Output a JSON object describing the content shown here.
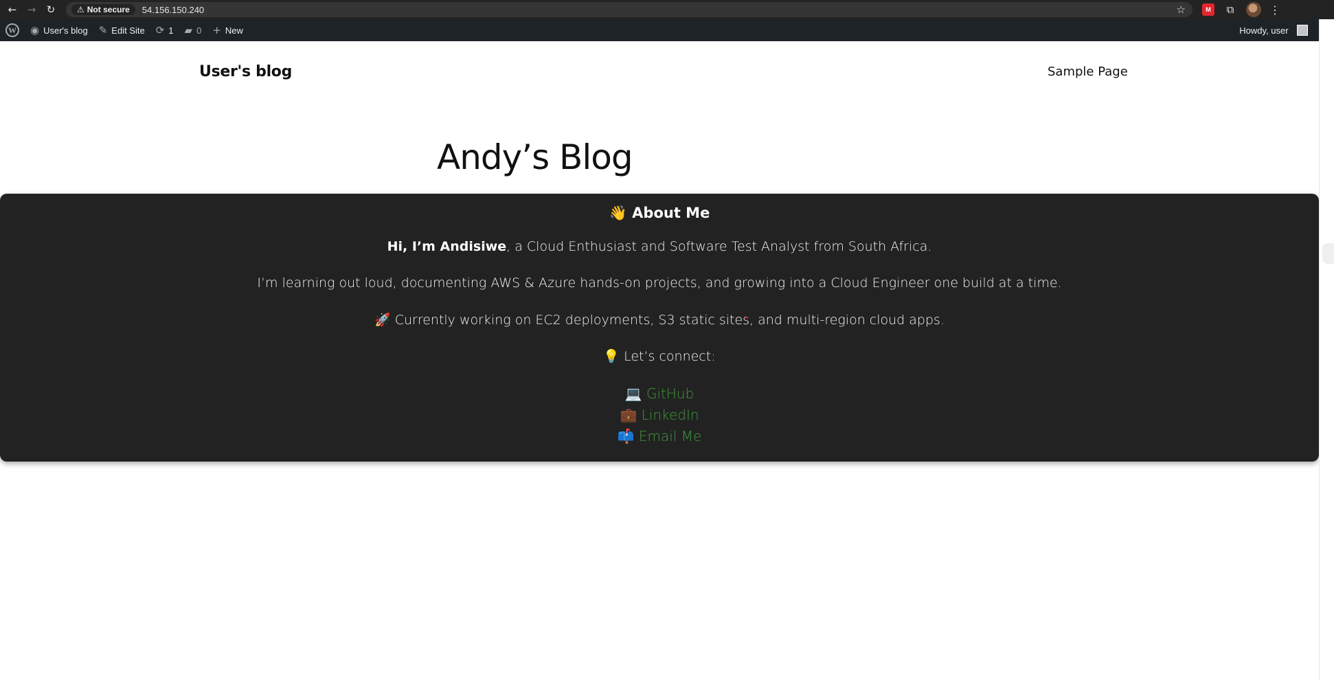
{
  "browser": {
    "back_icon": "arrow-left",
    "forward_icon": "arrow-right",
    "reload_icon": "reload",
    "security_label": "Not secure",
    "url": "54.156.150.240"
  },
  "admin_bar": {
    "site_name": "User's blog",
    "edit_site": "Edit Site",
    "updates_count": "1",
    "comments_count": "0",
    "new_label": "New",
    "howdy": "Howdy, user"
  },
  "site": {
    "title": "User's blog",
    "nav_link": "Sample Page"
  },
  "post": {
    "title": "Andy’s Blog"
  },
  "about": {
    "heading_emoji": "👋",
    "heading": "About Me",
    "intro_bold": "Hi, I’m Andisiwe",
    "intro_rest": ", a Cloud Enthusiast and Software Test Analyst from South Africa.",
    "learning": "I’m learning out loud, documenting AWS & Azure hands-on projects, and growing into a Cloud Engineer one build at a time.",
    "working_emoji": "🚀",
    "working": "Currently working on EC2 deployments, S3 static sites, and multi-region cloud apps.",
    "connect_emoji": "💡",
    "connect": "Let’s connect:",
    "links": [
      {
        "emoji": "💻",
        "label": "GitHub"
      },
      {
        "emoji": "💼",
        "label": "LinkedIn"
      },
      {
        "emoji": "📫",
        "label": "Email Me"
      }
    ]
  },
  "colors": {
    "admin_bar_bg": "#1d2327",
    "about_bg": "#222222",
    "link_green": "#3f9a3a"
  }
}
